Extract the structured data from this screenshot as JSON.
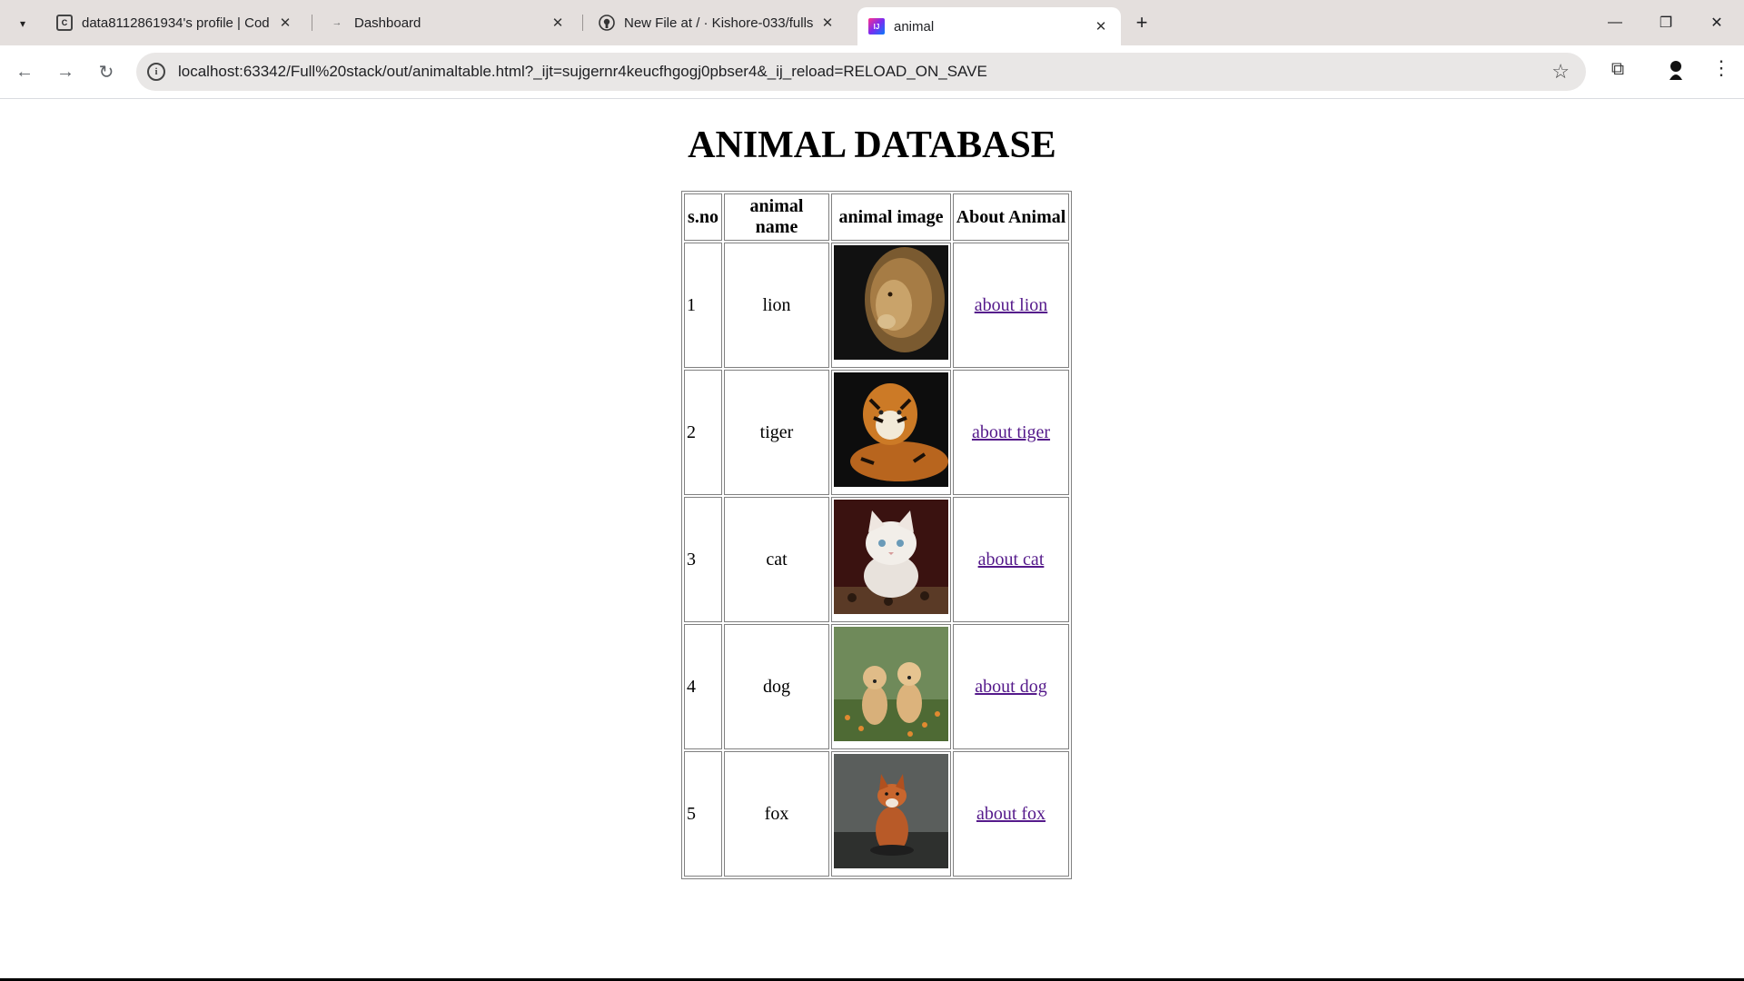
{
  "browser": {
    "tabs": [
      {
        "title": "data8112861934's profile | Cod",
        "favicon": "C",
        "active": false
      },
      {
        "title": "Dashboard",
        "favicon": "→",
        "active": false
      },
      {
        "title": "New File at / · Kishore-033/fulls",
        "favicon": "gh",
        "active": false
      },
      {
        "title": "animal",
        "favicon": "IJ",
        "active": true
      }
    ],
    "url": "localhost:63342/Full%20stack/out/animaltable.html?_ijt=sujgernr4keucfhgogj0pbser4&_ij_reload=RELOAD_ON_SAVE"
  },
  "page": {
    "heading": "ANIMAL DATABASE",
    "columns": [
      "s.no",
      "animal name",
      "animal image",
      "About Animal"
    ],
    "rows": [
      {
        "sno": "1",
        "name": "lion",
        "link": "about lion",
        "image_icon": "lion-image"
      },
      {
        "sno": "2",
        "name": "tiger",
        "link": "about tiger",
        "image_icon": "tiger-image"
      },
      {
        "sno": "3",
        "name": "cat",
        "link": "about cat",
        "image_icon": "cat-image"
      },
      {
        "sno": "4",
        "name": "dog",
        "link": "about dog",
        "image_icon": "dog-image"
      },
      {
        "sno": "5",
        "name": "fox",
        "link": "about fox",
        "image_icon": "fox-image"
      }
    ],
    "link_color": "#551a8b"
  }
}
